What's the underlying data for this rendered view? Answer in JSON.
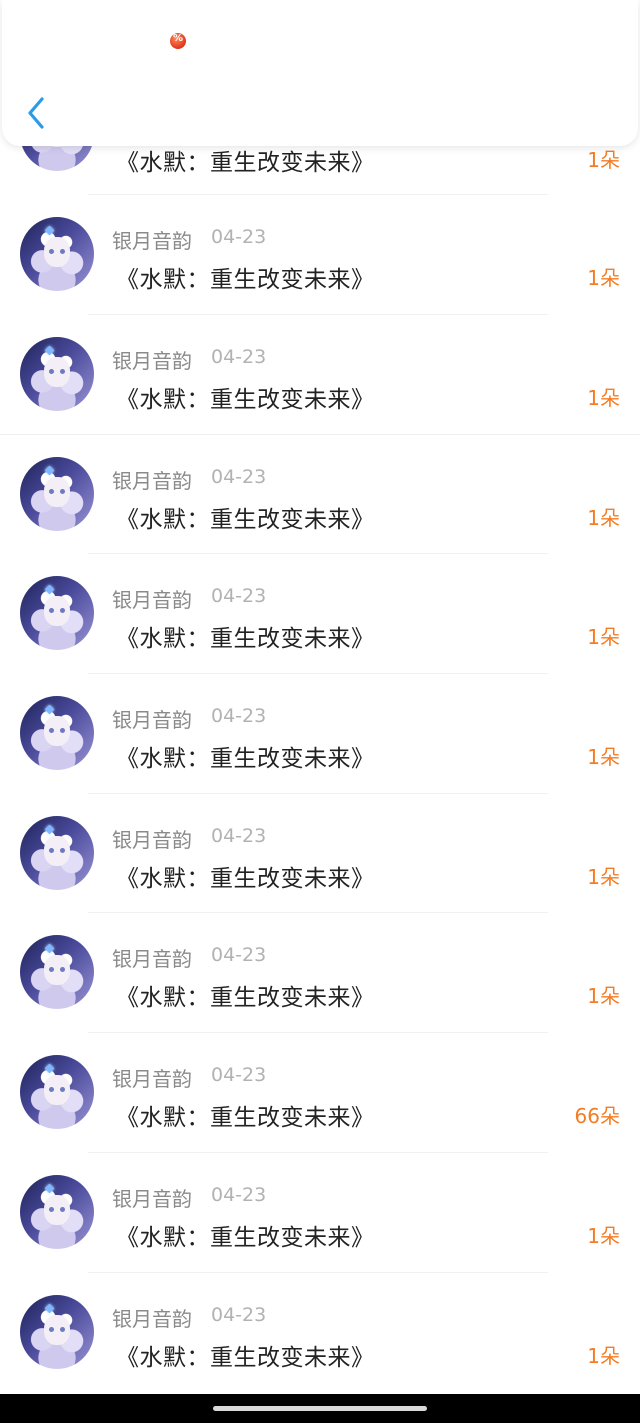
{
  "header": {
    "back_icon": "chevron-left-icon",
    "badge_icon": "percent-badge-icon"
  },
  "accent_color": "#f57c23",
  "items": [
    {
      "name": "银月音韵",
      "date": "04-23",
      "title": "《水默：重生改变未来》",
      "amount": "1朵"
    },
    {
      "name": "银月音韵",
      "date": "04-23",
      "title": "《水默：重生改变未来》",
      "amount": "1朵"
    },
    {
      "name": "银月音韵",
      "date": "04-23",
      "title": "《水默：重生改变未来》",
      "amount": "1朵"
    },
    {
      "name": "银月音韵",
      "date": "04-23",
      "title": "《水默：重生改变未来》",
      "amount": "1朵"
    },
    {
      "name": "银月音韵",
      "date": "04-23",
      "title": "《水默：重生改变未来》",
      "amount": "1朵"
    },
    {
      "name": "银月音韵",
      "date": "04-23",
      "title": "《水默：重生改变未来》",
      "amount": "1朵"
    },
    {
      "name": "银月音韵",
      "date": "04-23",
      "title": "《水默：重生改变未来》",
      "amount": "1朵"
    },
    {
      "name": "银月音韵",
      "date": "04-23",
      "title": "《水默：重生改变未来》",
      "amount": "66朵"
    },
    {
      "name": "银月音韵",
      "date": "04-23",
      "title": "《水默：重生改变未来》",
      "amount": "1朵"
    },
    {
      "name": "银月音韵",
      "date": "04-23",
      "title": "《水默：重生改变未来》",
      "amount": "1朵"
    },
    {
      "name": "银月音韵",
      "date": "04-23",
      "title": "《水默：重生改变未来》",
      "amount": "1朵"
    }
  ]
}
